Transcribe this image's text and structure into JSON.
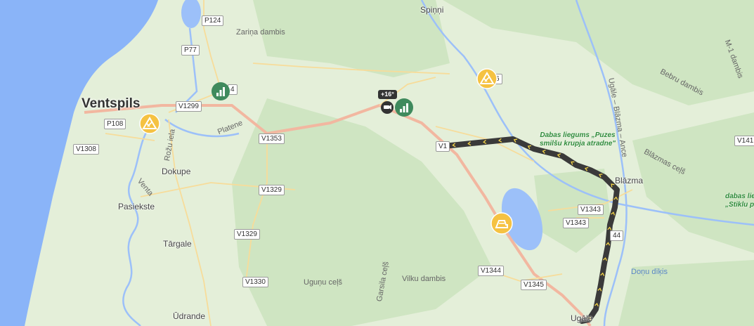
{
  "map": {
    "colors": {
      "sea": "#8ab4f8",
      "land": "#e4efd9",
      "forest": "#cfe5c2",
      "river": "#9cc0f9",
      "major_road": "#f2b7a0",
      "minor_road": "#f7dc9a",
      "route": "#3a3a3a",
      "route_arrow": "#f5d547",
      "park_label": "#2e8b3a"
    },
    "city_labels": [
      "Ventspils"
    ],
    "town_labels": [
      "Dokupe",
      "Pasiekste",
      "Tārgale",
      "Ūdrande",
      "Spiņņi",
      "Blāzma",
      "Ugāle"
    ],
    "street_labels": [
      "Zariņa dambis",
      "Platene",
      "Rožu iela",
      "Venta",
      "Bebru dambis",
      "M-1 dambis",
      "Ugāle – Blāzma – Ance",
      "Blāzmas ceļš",
      "Uguņu ceļš",
      "Garsila ceļš",
      "Vilku dambis",
      "Doņu dīķis"
    ],
    "park_labels": [
      "Dabas liegums „Puzes smilšu krupja atradne\"",
      "dabas lieg „Stiklu p"
    ],
    "road_shields": [
      "P124",
      "P77",
      "4",
      "V1299",
      "P108",
      "V1308",
      "V1353",
      "V1329",
      "V1329",
      "V1330",
      "V1344",
      "V1345",
      "V1343",
      "V1343",
      "44",
      "V141",
      "6",
      "V1"
    ],
    "temperature": "+16°",
    "markers": [
      "roadworks-icon",
      "roadworks-icon",
      "signal-icon",
      "signal-icon",
      "speed-camera-icon",
      "snowplow-icon"
    ]
  }
}
